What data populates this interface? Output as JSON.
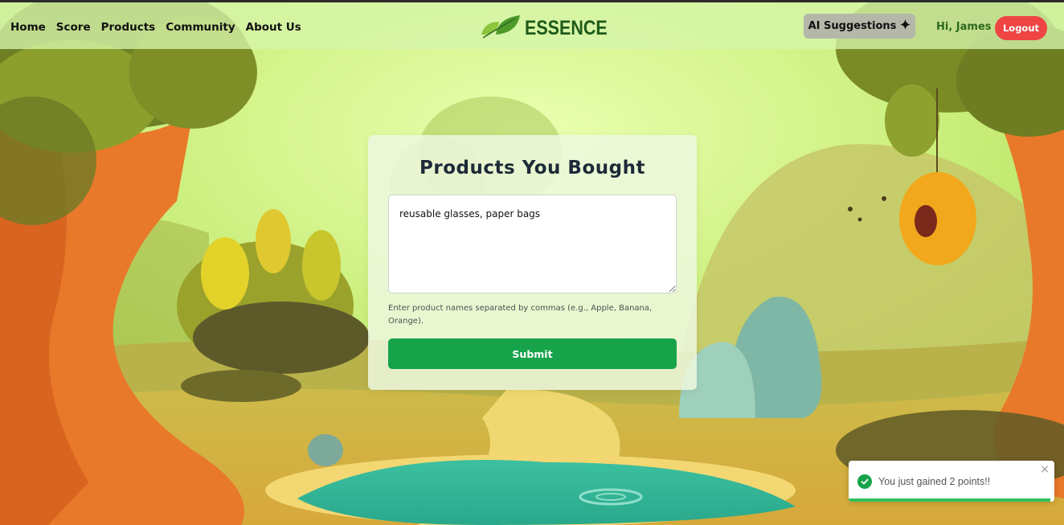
{
  "nav": {
    "items": [
      {
        "label": "Home"
      },
      {
        "label": "Score"
      },
      {
        "label": "Products"
      },
      {
        "label": "Community"
      },
      {
        "label": "About Us"
      }
    ]
  },
  "brand": {
    "name": "ESSENCE"
  },
  "header": {
    "ai_label": "AI Suggestions",
    "ai_icon": "sparkle-icon",
    "greeting": "Hi, James",
    "logout_label": "Logout"
  },
  "form": {
    "title": "Products You Bought",
    "textarea_value": "reusable glasses, paper bags",
    "hint": "Enter product names separated by commas (e.g., Apple, Banana, Orange).",
    "submit_label": "Submit"
  },
  "toast": {
    "message": "You just gained 2 points!!",
    "close_symbol": "×",
    "progress": 0.98
  },
  "colors": {
    "accent_green": "#16a34a",
    "logout_red": "#ef4444",
    "brand_dark_green": "#1f5a1a"
  }
}
